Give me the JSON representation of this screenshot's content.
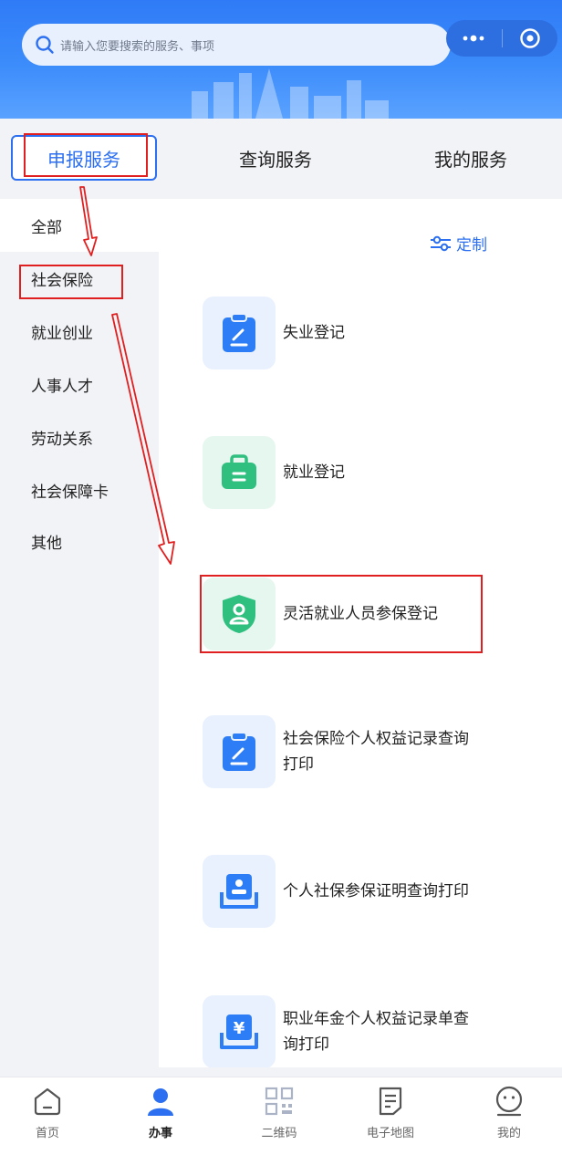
{
  "search": {
    "placeholder": "请输入您要搜索的服务、事项"
  },
  "top_tabs": [
    {
      "label": "申报服务",
      "active": true
    },
    {
      "label": "查询服务",
      "active": false
    },
    {
      "label": "我的服务",
      "active": false
    }
  ],
  "sidebar": {
    "items": [
      {
        "label": "全部",
        "active": true
      },
      {
        "label": "社会保险",
        "active": false
      },
      {
        "label": "就业创业",
        "active": false
      },
      {
        "label": "人事人才",
        "active": false
      },
      {
        "label": "劳动关系",
        "active": false
      },
      {
        "label": "社会保障卡",
        "active": false
      },
      {
        "label": "其他",
        "active": false
      }
    ]
  },
  "panel": {
    "customize_label": "定制",
    "services": [
      {
        "label": "失业登记",
        "icon": "clipboard-edit-icon"
      },
      {
        "label": "就业登记",
        "icon": "briefcase-icon"
      },
      {
        "label": "灵活就业人员参保登记",
        "icon": "shield-user-icon"
      },
      {
        "label": "社会保险个人权益记录查询打印",
        "icon": "clipboard-edit-icon"
      },
      {
        "label": "个人社保参保证明查询打印",
        "icon": "id-card-icon"
      },
      {
        "label": "职业年金个人权益记录单查询打印",
        "icon": "yuan-document-icon"
      }
    ]
  },
  "bottom_nav": [
    {
      "label": "首页",
      "icon": "home-icon",
      "active": false
    },
    {
      "label": "办事",
      "icon": "person-icon",
      "active": true
    },
    {
      "label": "二维码",
      "icon": "qr-code-icon",
      "active": false
    },
    {
      "label": "电子地图",
      "icon": "document-icon",
      "active": false
    },
    {
      "label": "我的",
      "icon": "smile-icon",
      "active": false
    }
  ],
  "colors": {
    "brand_blue": "#2c6ff0",
    "header_blue": "#3c8cfb",
    "highlight_red": "#e02020",
    "green": "#2fbf7f"
  }
}
